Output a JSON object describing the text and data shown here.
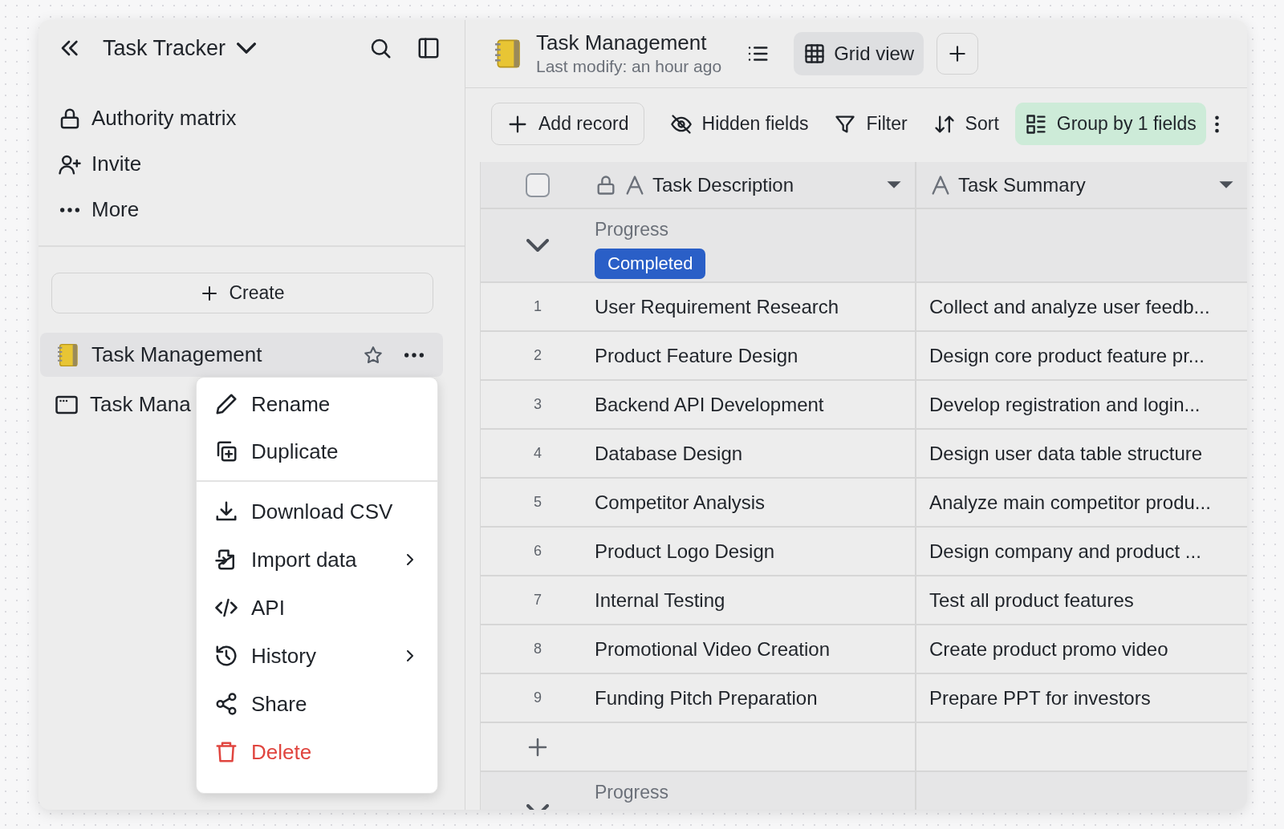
{
  "sidebar": {
    "title": "Task Tracker",
    "nav": [
      {
        "kind": "lock",
        "label": "Authority matrix"
      },
      {
        "kind": "invite",
        "label": "Invite"
      },
      {
        "kind": "more",
        "label": "More"
      }
    ],
    "create": "Create",
    "documents": [
      {
        "kind": "notebook",
        "label": "Task Management",
        "selected": true
      },
      {
        "kind": "window",
        "label": "Task Mana",
        "selected": false
      }
    ]
  },
  "context_menu": [
    {
      "kind": "rename",
      "label": "Rename",
      "submenu": false,
      "danger": false,
      "divider_after": false
    },
    {
      "kind": "duplicate",
      "label": "Duplicate",
      "submenu": false,
      "danger": false,
      "divider_after": true
    },
    {
      "kind": "download",
      "label": "Download CSV",
      "submenu": false,
      "danger": false,
      "divider_after": false
    },
    {
      "kind": "import",
      "label": "Import data",
      "submenu": true,
      "danger": false,
      "divider_after": false
    },
    {
      "kind": "api",
      "label": "API",
      "submenu": false,
      "danger": false,
      "divider_after": false
    },
    {
      "kind": "history",
      "label": "History",
      "submenu": true,
      "danger": false,
      "divider_after": false
    },
    {
      "kind": "share",
      "label": "Share",
      "submenu": false,
      "danger": false,
      "divider_after": false
    },
    {
      "kind": "delete",
      "label": "Delete",
      "submenu": false,
      "danger": true,
      "divider_after": false
    }
  ],
  "header": {
    "title": "Task Management",
    "subtitle": "Last modify: an hour ago",
    "view": {
      "label": "Grid view",
      "selected": true
    }
  },
  "toolbar": [
    {
      "kind": "add",
      "label": "Add record",
      "active": false
    },
    {
      "kind": "hidden",
      "label": "Hidden fields",
      "active": false
    },
    {
      "kind": "filter",
      "label": "Filter",
      "active": false
    },
    {
      "kind": "sort",
      "label": "Sort",
      "active": false
    },
    {
      "kind": "group",
      "label": "Group by 1 fields",
      "active": true
    }
  ],
  "table": {
    "select_all": {
      "checked": false
    },
    "columns": [
      {
        "label": "Task Description",
        "locked": true
      },
      {
        "label": "Task Summary",
        "locked": false
      }
    ],
    "groups": [
      {
        "field": "Progress",
        "value": "Completed",
        "color": "#2a5fc7",
        "expanded": true,
        "rows": [
          {
            "number": "1",
            "cells": [
              "User Requirement Research",
              "Collect and analyze user feedb..."
            ]
          },
          {
            "number": "2",
            "cells": [
              "Product Feature Design",
              "Design core product feature pr..."
            ]
          },
          {
            "number": "3",
            "cells": [
              "Backend API Development",
              "Develop registration and login..."
            ]
          },
          {
            "number": "4",
            "cells": [
              "Database Design",
              "Design user data table structure"
            ]
          },
          {
            "number": "5",
            "cells": [
              "Competitor Analysis",
              "Analyze main competitor produ..."
            ]
          },
          {
            "number": "6",
            "cells": [
              "Product Logo Design",
              "Design company and product ..."
            ]
          },
          {
            "number": "7",
            "cells": [
              "Internal Testing",
              "Test all product features"
            ]
          },
          {
            "number": "8",
            "cells": [
              "Promotional Video Creation",
              "Create product promo video"
            ]
          },
          {
            "number": "9",
            "cells": [
              "Funding Pitch Preparation",
              "Prepare PPT for investors"
            ]
          }
        ]
      },
      {
        "field": "Progress",
        "expanded": true
      }
    ]
  }
}
